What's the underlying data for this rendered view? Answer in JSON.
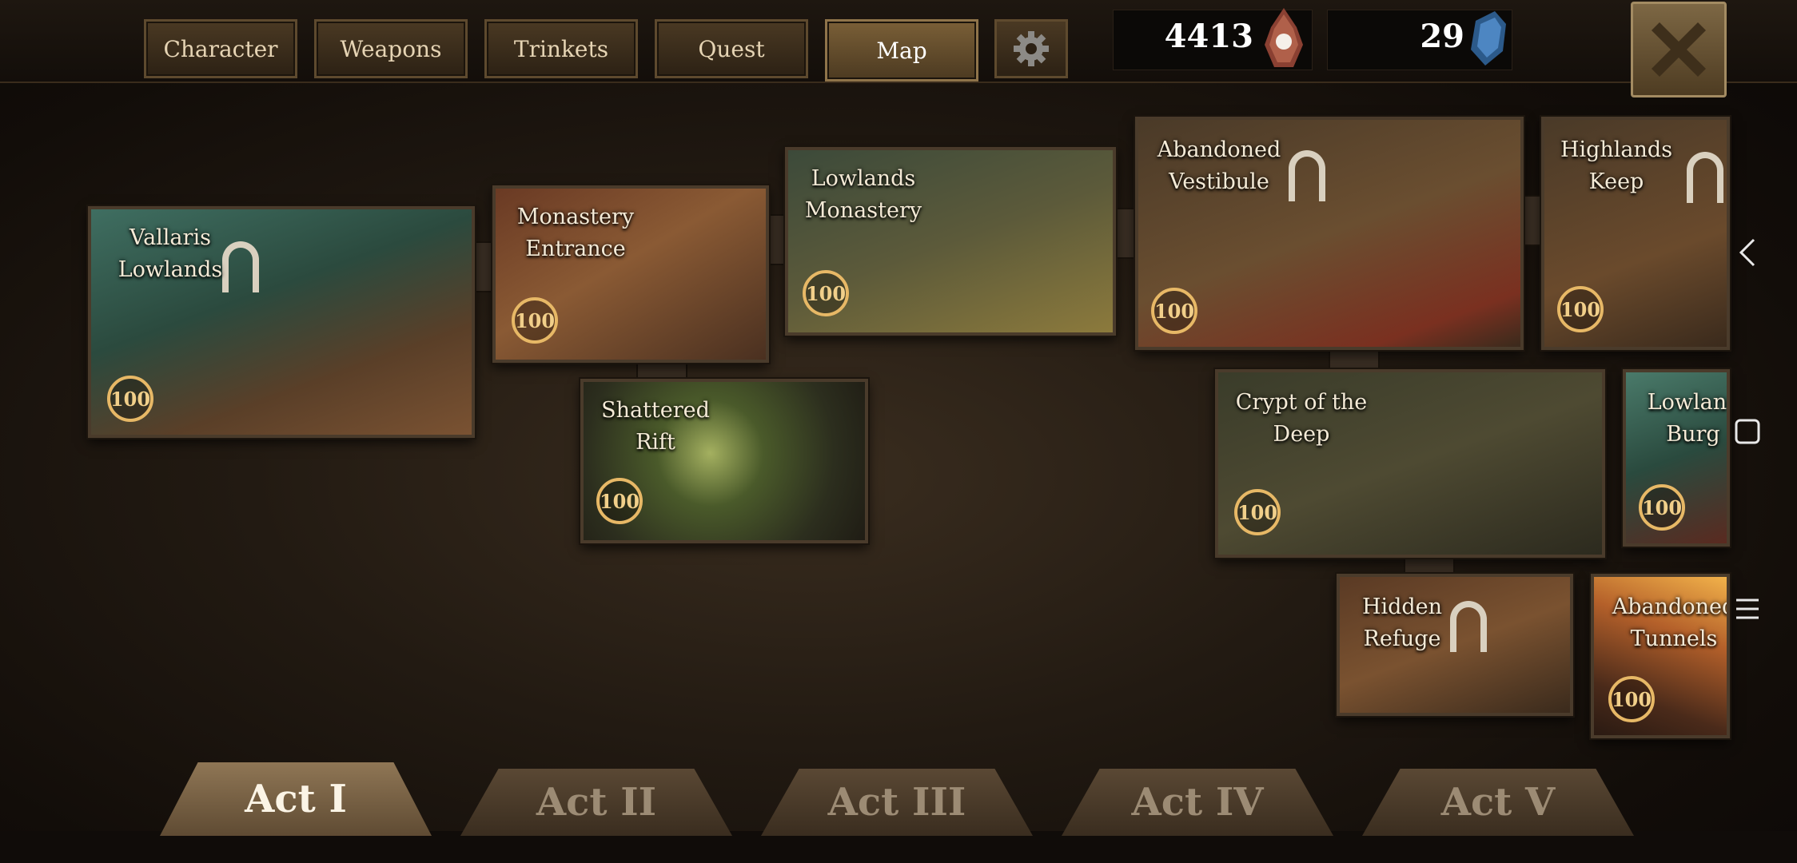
{
  "tabs": [
    {
      "label": "Character"
    },
    {
      "label": "Weapons"
    },
    {
      "label": "Trinkets"
    },
    {
      "label": "Quest"
    },
    {
      "label": "Map",
      "active": true
    }
  ],
  "currency": {
    "souls": "4413",
    "gems": "29"
  },
  "map_tiles": [
    {
      "name_line1": "Vallaris",
      "name_line2": "Lowlands",
      "score": "100"
    },
    {
      "name_line1": "Monastery",
      "name_line2": "Entrance",
      "score": "100"
    },
    {
      "name_line1": "Lowlands",
      "name_line2": "Monastery",
      "score": "100"
    },
    {
      "name_line1": "Abandoned",
      "name_line2": "Vestibule",
      "score": "100"
    },
    {
      "name_line1": "Highlands",
      "name_line2": "Keep",
      "score": "100"
    },
    {
      "name_line1": "Shattered",
      "name_line2": "Rift",
      "score": "100"
    },
    {
      "name_line1": "Crypt of the",
      "name_line2": "Deep",
      "score": "100"
    },
    {
      "name_line1": "Lowlanc",
      "name_line2": "Burg",
      "score": "100"
    },
    {
      "name_line1": "Hidden",
      "name_line2": "Refuge",
      "score": "100"
    },
    {
      "name_line1": "Abandoned",
      "name_line2": "Tunnels",
      "score": "100"
    }
  ],
  "acts": [
    {
      "label": "Act I",
      "active": true
    },
    {
      "label": "Act II"
    },
    {
      "label": "Act III"
    },
    {
      "label": "Act IV"
    },
    {
      "label": "Act V"
    }
  ],
  "icons": {
    "settings": "gear-icon",
    "close": "close-icon",
    "soul_currency": "soul-orb-icon",
    "gem_currency": "blue-gem-icon",
    "nav_back": "back-icon",
    "nav_home": "home-icon",
    "nav_recents": "menu-icon"
  },
  "colors": {
    "badge_ring": "#e7b866",
    "tab_active": "#7a5f37",
    "act_active": "#8f7655"
  }
}
